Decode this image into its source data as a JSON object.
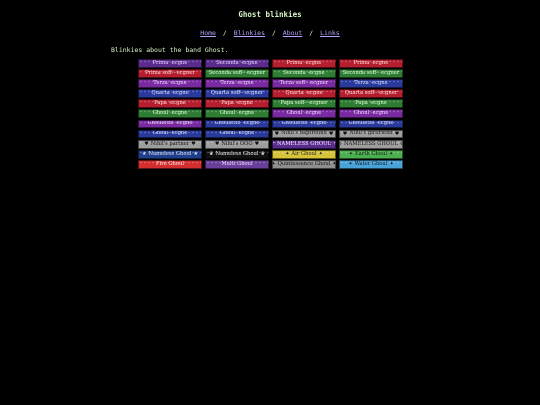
{
  "page": {
    "title": "Ghost blinkies",
    "intro": "Blinkies about the band Ghost."
  },
  "nav": {
    "links": [
      "Home",
      "Blinkies",
      "About",
      "Links"
    ],
    "separator": "/"
  },
  "blinkies": [
    {
      "text": "Prima ·ecgne",
      "bg": "#5a2a8c",
      "fg": "#e6d7ff",
      "icon": ""
    },
    {
      "text": "Seconda ·ecgne",
      "bg": "#5a2a8c",
      "fg": "#e6d7ff",
      "icon": ""
    },
    {
      "text": "Prima ·ecgne",
      "bg": "#b51e2e",
      "fg": "#ffe0e0",
      "icon": ""
    },
    {
      "text": "Prima ·ecgne",
      "bg": "#b51e2e",
      "fg": "#ffe0e0",
      "icon": ""
    },
    {
      "text": "Prima soff-··ecgner",
      "bg": "#b51e2e",
      "fg": "#ffe0e0",
      "icon": ""
    },
    {
      "text": "Seconda soff-··ecgner",
      "bg": "#2e7d32",
      "fg": "#e0ffe0",
      "icon": ""
    },
    {
      "text": "Seconda ·ecgne",
      "bg": "#2e7d32",
      "fg": "#e0ffe0",
      "icon": ""
    },
    {
      "text": "Seconda soff-··ecgner",
      "bg": "#2e7d32",
      "fg": "#e0ffe0",
      "icon": ""
    },
    {
      "text": "Terza ·ecgne",
      "bg": "#7a2aa0",
      "fg": "#f0ddff",
      "icon": ""
    },
    {
      "text": "Terza ·ecgne",
      "bg": "#7a2aa0",
      "fg": "#f0ddff",
      "icon": ""
    },
    {
      "text": "Terza soff-··ecgner",
      "bg": "#7a2aa0",
      "fg": "#f0ddff",
      "icon": ""
    },
    {
      "text": "Terza ·ecgne",
      "bg": "#2a3a9c",
      "fg": "#dde3ff",
      "icon": ""
    },
    {
      "text": "Quarta ·ecgne",
      "bg": "#2a3a9c",
      "fg": "#dde3ff",
      "icon": ""
    },
    {
      "text": "Quarta soff-··ecgner",
      "bg": "#2a3a9c",
      "fg": "#dde3ff",
      "icon": ""
    },
    {
      "text": "Quarta ·ecgne",
      "bg": "#b51e2e",
      "fg": "#ffe0e0",
      "icon": ""
    },
    {
      "text": "Quarta soff-··ecgner",
      "bg": "#b51e2e",
      "fg": "#ffe0e0",
      "icon": ""
    },
    {
      "text": "Papa ·ecgne",
      "bg": "#b51e2e",
      "fg": "#ffe0e0",
      "icon": ""
    },
    {
      "text": "Papa ·ecgne",
      "bg": "#b51e2e",
      "fg": "#ffe0e0",
      "icon": ""
    },
    {
      "text": "Papa soff-··ecgner",
      "bg": "#2e7d32",
      "fg": "#e0ffe0",
      "icon": ""
    },
    {
      "text": "Papa ·ecgne",
      "bg": "#2e7d32",
      "fg": "#e0ffe0",
      "icon": ""
    },
    {
      "text": "Ghoul ·ecgne",
      "bg": "#2e7d32",
      "fg": "#e0ffe0",
      "icon": ""
    },
    {
      "text": "Ghoul ·ecgne",
      "bg": "#2e7d32",
      "fg": "#e0ffe0",
      "icon": ""
    },
    {
      "text": "Ghoul ·ecgne",
      "bg": "#7a2aa0",
      "fg": "#f0ddff",
      "icon": ""
    },
    {
      "text": "Ghoul ·ecgne",
      "bg": "#7a2aa0",
      "fg": "#f0ddff",
      "icon": ""
    },
    {
      "text": "Ghoulette ·ecgne",
      "bg": "#7a2aa0",
      "fg": "#f0ddff",
      "icon": ""
    },
    {
      "text": "Ghoulette ·ecgne",
      "bg": "#2a3a9c",
      "fg": "#dde3ff",
      "icon": ""
    },
    {
      "text": "Ghoulette ·ecgne",
      "bg": "#2a3a9c",
      "fg": "#dde3ff",
      "icon": ""
    },
    {
      "text": "Ghoulette ·ecgne",
      "bg": "#2a3a9c",
      "fg": "#dde3ff",
      "icon": ""
    },
    {
      "text": "Ghoul ·ecgne",
      "bg": "#2a3a9c",
      "fg": "#dde3ff",
      "icon": ""
    },
    {
      "text": "Ghoul ·ecgne",
      "bg": "#2a3a9c",
      "fg": "#dde3ff",
      "icon": ""
    },
    {
      "text": "Nihil's bapfreund",
      "bg": "#9e9e9e",
      "fg": "#111111",
      "icon": "♥"
    },
    {
      "text": "Nihil's girlfriend",
      "bg": "#9e9e9e",
      "fg": "#111111",
      "icon": "♥"
    },
    {
      "text": "Nihil's partner",
      "bg": "#9e9e9e",
      "fg": "#111111",
      "icon": "♥"
    },
    {
      "text": "Nihil's OOO",
      "bg": "#9e9e9e",
      "fg": "#111111",
      "icon": "♥"
    },
    {
      "text": "NAMELESS GHOUL",
      "bg": "#5a2a8c",
      "fg": "#f5ecff",
      "icon": "✝"
    },
    {
      "text": "NAMELESS GHOUL",
      "bg": "#9e9e9e",
      "fg": "#111111",
      "icon": "⚙"
    },
    {
      "text": "Nameless Ghoul",
      "bg": "#1f3f8a",
      "fg": "#dde3ff",
      "icon": "★"
    },
    {
      "text": "Nameless Ghoul",
      "bg": "#111111",
      "fg": "#eeeeee",
      "icon": "♛"
    },
    {
      "text": "Air Ghoul",
      "bg": "#d6c53a",
      "fg": "#222222",
      "icon": "✦"
    },
    {
      "text": "Earth Ghoul",
      "bg": "#4caf50",
      "fg": "#102010",
      "icon": "✦"
    },
    {
      "text": "Fire Ghoul",
      "bg": "#d32f2f",
      "fg": "#fff0f0",
      "icon": ""
    },
    {
      "text": "Multi Ghoul",
      "bg": "#6a3f9c",
      "fg": "#f0e0ff",
      "icon": ""
    },
    {
      "text": "Quintessence Ghoul",
      "bg": "#8e8e8e",
      "fg": "#111111",
      "icon": "✦"
    },
    {
      "text": "Water Ghoul",
      "bg": "#4aa3d8",
      "fg": "#061a2a",
      "icon": "✦"
    }
  ]
}
